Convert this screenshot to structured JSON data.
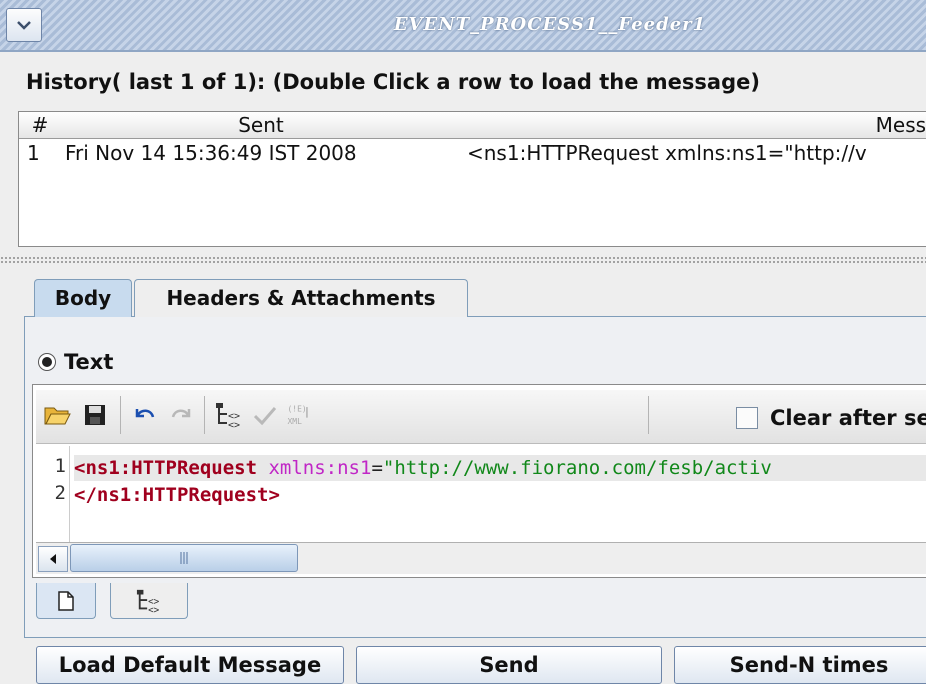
{
  "window": {
    "title": "EVENT_PROCESS1__Feeder1"
  },
  "history": {
    "label": "History( last 1 of 1):    (Double Click a row to load the message)",
    "columns": [
      "#",
      "Sent",
      "Messag"
    ],
    "rows": [
      {
        "num": "1",
        "sent": "Fri Nov 14 15:36:49 IST 2008",
        "message": "<ns1:HTTPRequest xmlns:ns1=\"http://v"
      }
    ]
  },
  "tabs": {
    "body": "Body",
    "headers": "Headers & Attachments"
  },
  "body": {
    "radio_label": "Text"
  },
  "toolbar": {
    "clear_label": "Clear after se",
    "icons": [
      "open-folder-icon",
      "save-icon",
      "undo-icon",
      "redo-icon",
      "xml-tree-icon",
      "validate-check-icon",
      "xml-encode-icon"
    ]
  },
  "editor": {
    "line_numbers": [
      "1",
      "2"
    ],
    "line1": {
      "open_tag": "<ns1:HTTPRequest",
      "attr": "xmlns:ns1",
      "eq": "=",
      "value": "\"http://www.fiorano.com/fesb/activ"
    },
    "line2": {
      "close_tag": "</ns1:HTTPRequest>"
    }
  },
  "buttons": {
    "load_default": "Load Default Message",
    "send": "Send",
    "send_n": "Send-N times"
  },
  "colors": {
    "title_bar": "#a9bcd7",
    "tag": "#a0001e",
    "attribute": "#c026c6",
    "string": "#11881a"
  }
}
